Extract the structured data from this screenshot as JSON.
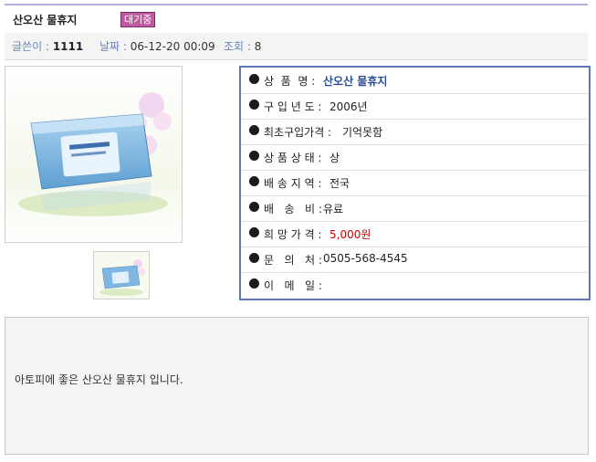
{
  "header": {
    "title": "산오산 물휴지",
    "badge": "대기중"
  },
  "meta": {
    "author_label": "글쓴이 :",
    "author_value": "1111",
    "date_label": "날짜 :",
    "date_value": "06-12-20 00:09",
    "views_label": "조회 :",
    "views_value": "8"
  },
  "info": {
    "rows": [
      {
        "label": "상  품  명 :",
        "value": "산오산 물휴지"
      },
      {
        "label": "구 입 년 도 :",
        "value": "2006년"
      },
      {
        "label": "최초구입가격 :",
        "value": "기억못함"
      },
      {
        "label": "상 품 상 태 :",
        "value": "상"
      },
      {
        "label": "배 송 지 역 :",
        "value": "전국"
      },
      {
        "label": "배   송   비 :",
        "value": "유료"
      },
      {
        "label": "희 망 가 격 :",
        "value": "5,000원"
      },
      {
        "label": "문   의   처 :",
        "value": "0505-568-4545"
      },
      {
        "label": "이   메   일 :",
        "value": ""
      }
    ]
  },
  "description": "아토피에 좋은 산오산 물휴지 입니다.",
  "icons": {
    "photo": "wet-tissue-box-photo",
    "thumb": "wet-tissue-box-thumbnail"
  },
  "colors": {
    "accent_border": "#5d76b8",
    "badge": "#c05aa0",
    "price": "#cc0000",
    "label_blue": "#6a84b5"
  }
}
